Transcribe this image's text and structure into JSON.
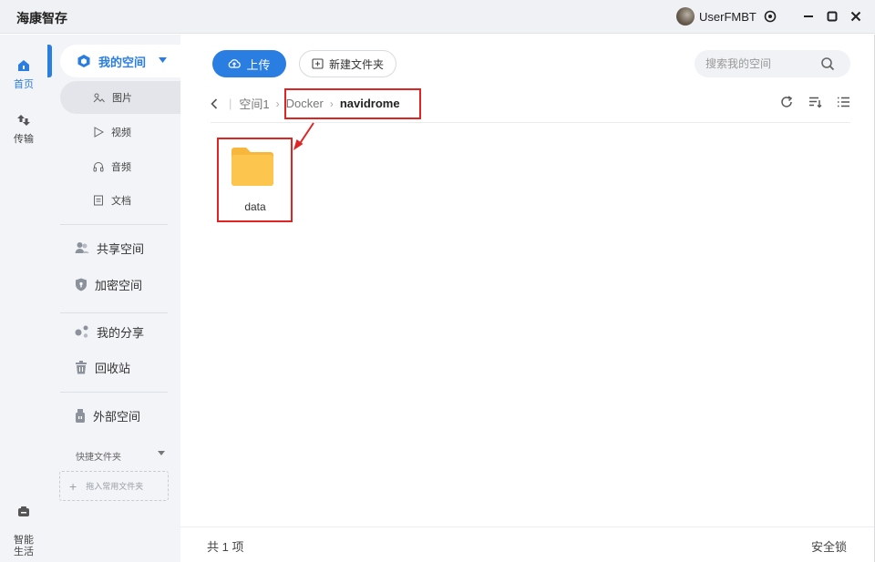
{
  "app": {
    "title": "海康智存"
  },
  "user": {
    "name": "UserFMBT"
  },
  "rail": {
    "items": [
      {
        "label": "首页",
        "icon": "home-icon"
      },
      {
        "label": "传输",
        "icon": "transfer-icon"
      },
      {
        "label": "智能\n生活",
        "icon": "smart-life-icon"
      }
    ]
  },
  "sidebar": {
    "my_space": "我的空间",
    "sub_items": [
      {
        "label": "图片",
        "icon": "picture-icon"
      },
      {
        "label": "视频",
        "icon": "video-icon"
      },
      {
        "label": "音频",
        "icon": "audio-icon"
      },
      {
        "label": "文档",
        "icon": "document-icon"
      }
    ],
    "items": [
      {
        "label": "共享空间",
        "icon": "shared-space-icon"
      },
      {
        "label": "加密空间",
        "icon": "encrypted-space-icon"
      },
      {
        "label": "我的分享",
        "icon": "my-share-icon"
      },
      {
        "label": "回收站",
        "icon": "recycle-bin-icon"
      },
      {
        "label": "外部空间",
        "icon": "external-space-icon"
      }
    ],
    "quick_folder": "快捷文件夹",
    "quick_drop": "拖入常用文件夹"
  },
  "toolbar": {
    "upload_label": "上传",
    "new_folder_label": "新建文件夹",
    "search_placeholder": "搜索我的空间"
  },
  "breadcrumb": {
    "items": [
      "空间1",
      "Docker"
    ],
    "current": "navidrome"
  },
  "files": [
    {
      "name": "data",
      "type": "folder"
    }
  ],
  "footer": {
    "count": "共 1 项",
    "lock": "安全锁"
  },
  "colors": {
    "accent": "#2a7de1",
    "highlight": "#e02424",
    "folder": "#fcc54e"
  }
}
